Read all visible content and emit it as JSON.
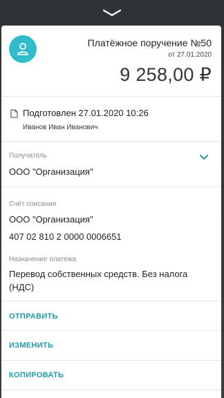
{
  "document": {
    "title": "Платёжное поручение №50",
    "date": "от 27.01.2020",
    "amount": "9 258,00 ₽"
  },
  "status": {
    "text": "Подготовлен 27.01.2020 10:26",
    "author": "Иванов Иван Иванович"
  },
  "recipient": {
    "label": "Получатель",
    "value": "ООО \"Организация\""
  },
  "debit_account": {
    "label": "Счёт списания",
    "name": "ООО \"Организация\"",
    "number": "407 02 810 2 0000 0006651"
  },
  "purpose": {
    "label": "Назначение платежа",
    "text": "Перевод собственных средств. Без налога (НДС)"
  },
  "actions": {
    "send": "ОТПРАВИТЬ",
    "edit": "ИЗМЕНИТЬ",
    "copy": "КОПИРОВАТЬ"
  },
  "colors": {
    "accent": "#1e9aa7",
    "avatar": "#2fbccd"
  }
}
